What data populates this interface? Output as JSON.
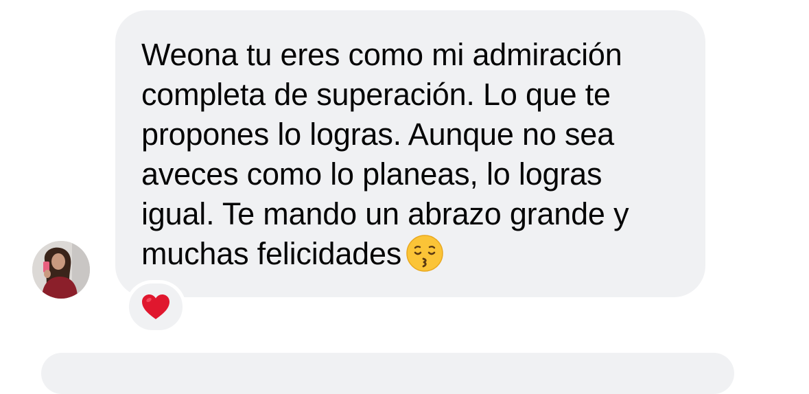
{
  "conversation": {
    "incoming_message": {
      "sender_avatar": "profile-photo-avatar",
      "text": "Weona tu eres como mi admiración\ncompleta de superación. Lo que te\npropones lo logras. Aunque no sea\naveces como lo planeas, lo logras\nigual. Te mando un abrazo grande y\nmuchas felicidades",
      "trailing_emoji": "kissing-face-with-closed-eyes-emoji",
      "reaction": "red-heart-emoji"
    }
  },
  "colors": {
    "bubble_background": "#f0f1f3",
    "text": "#050505",
    "heart": "#e0172e",
    "emoji_yellow": "#fbc437"
  }
}
